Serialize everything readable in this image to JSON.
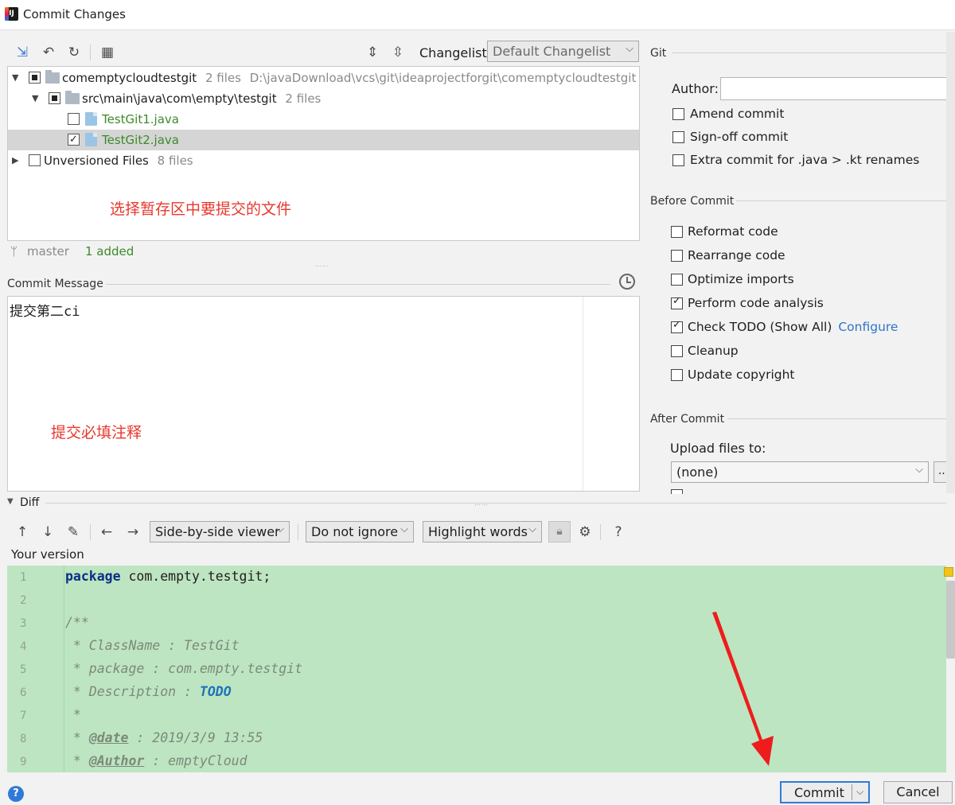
{
  "window": {
    "title": "Commit Changes"
  },
  "toolbar": {
    "changelist_label": "Changelist:",
    "changelist_value": "Default Changelist"
  },
  "tree": {
    "root": {
      "name": "comemptycloudtestgit",
      "count": "2 files",
      "path": "D:\\javaDownload\\vcs\\git\\ideaprojectforgit\\comemptycloudtestgit"
    },
    "folder": {
      "name": "src\\main\\java\\com\\empty\\testgit",
      "count": "2 files"
    },
    "files": [
      {
        "name": "TestGit1.java",
        "checked": false
      },
      {
        "name": "TestGit2.java",
        "checked": true
      }
    ],
    "unversioned": {
      "name": "Unversioned Files",
      "count": "8 files"
    },
    "annotation": "选择暂存区中要提交的文件"
  },
  "status": {
    "branch": "master",
    "added": "1 added"
  },
  "commit_message": {
    "label": "Commit Message",
    "text": "提交第二ci",
    "annotation": "提交必填注释"
  },
  "git": {
    "label": "Git",
    "author_label": "Author:",
    "author_value": "",
    "options": [
      "Amend commit",
      "Sign-off commit",
      "Extra commit for .java > .kt renames"
    ]
  },
  "before_commit": {
    "label": "Before Commit",
    "options": [
      {
        "label": "Reformat code",
        "checked": false
      },
      {
        "label": "Rearrange code",
        "checked": false
      },
      {
        "label": "Optimize imports",
        "checked": false
      },
      {
        "label": "Perform code analysis",
        "checked": true
      },
      {
        "label": "Check TODO (Show All)",
        "checked": true
      },
      {
        "label": "Cleanup",
        "checked": false
      },
      {
        "label": "Update copyright",
        "checked": false
      }
    ],
    "configure_link": "Configure"
  },
  "after_commit": {
    "label": "After Commit",
    "upload_label": "Upload files to:",
    "upload_value": "(none)",
    "browse": "..."
  },
  "diff": {
    "label": "Diff",
    "viewer": "Side-by-side viewer",
    "ignore": "Do not ignore",
    "highlight": "Highlight words",
    "version_label": "Your version",
    "help": "?",
    "lines": [
      {
        "n": "1",
        "t": "package com.empty.testgit;"
      },
      {
        "n": "2",
        "t": ""
      },
      {
        "n": "3",
        "t": "/**"
      },
      {
        "n": "4",
        "t": " * ClassName : TestGit"
      },
      {
        "n": "5",
        "t": " * package : com.empty.testgit"
      },
      {
        "n": "6",
        "t": " * Description : TODO"
      },
      {
        "n": "7",
        "t": " *"
      },
      {
        "n": "8",
        "t": " * @date : 2019/3/9 13:55"
      },
      {
        "n": "9",
        "t": " * @Author : emptyCloud"
      }
    ]
  },
  "footer": {
    "commit": "Commit",
    "cancel": "Cancel",
    "help": "?"
  }
}
